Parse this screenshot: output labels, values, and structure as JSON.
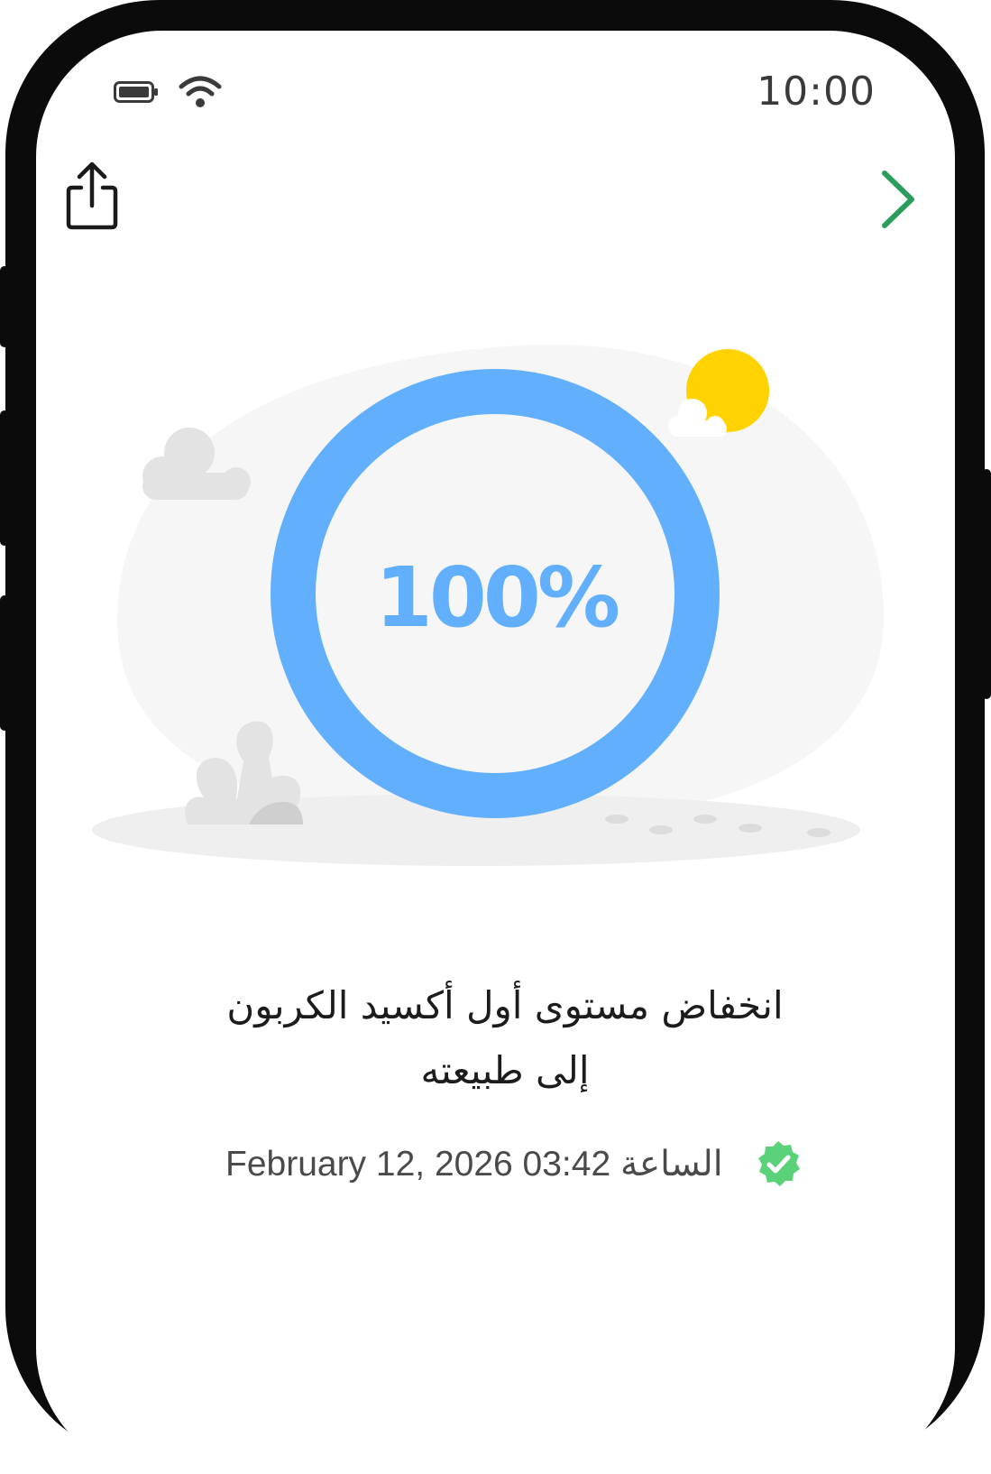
{
  "status_bar": {
    "time": "10:00",
    "icons": [
      "battery-icon",
      "wifi-icon"
    ]
  },
  "toolbar": {
    "share_icon": "share-icon",
    "next_icon": "chevron-right-icon"
  },
  "progress": {
    "label": "100%",
    "value": 1.0,
    "color": "#62b0fd"
  },
  "notification": {
    "title_line1": "انخفاض مستوى أول أكسيد الكربون",
    "title_line2": "إلى طبيعته",
    "timestamp": "February 12, 2026 الساعة 03:42",
    "verified_icon": "verified-badge-icon",
    "verified_color": "#5bd27a"
  },
  "colors": {
    "accent_green": "#2a9d5c",
    "sun": "#ffd200",
    "frame": "#0b0b0b"
  }
}
